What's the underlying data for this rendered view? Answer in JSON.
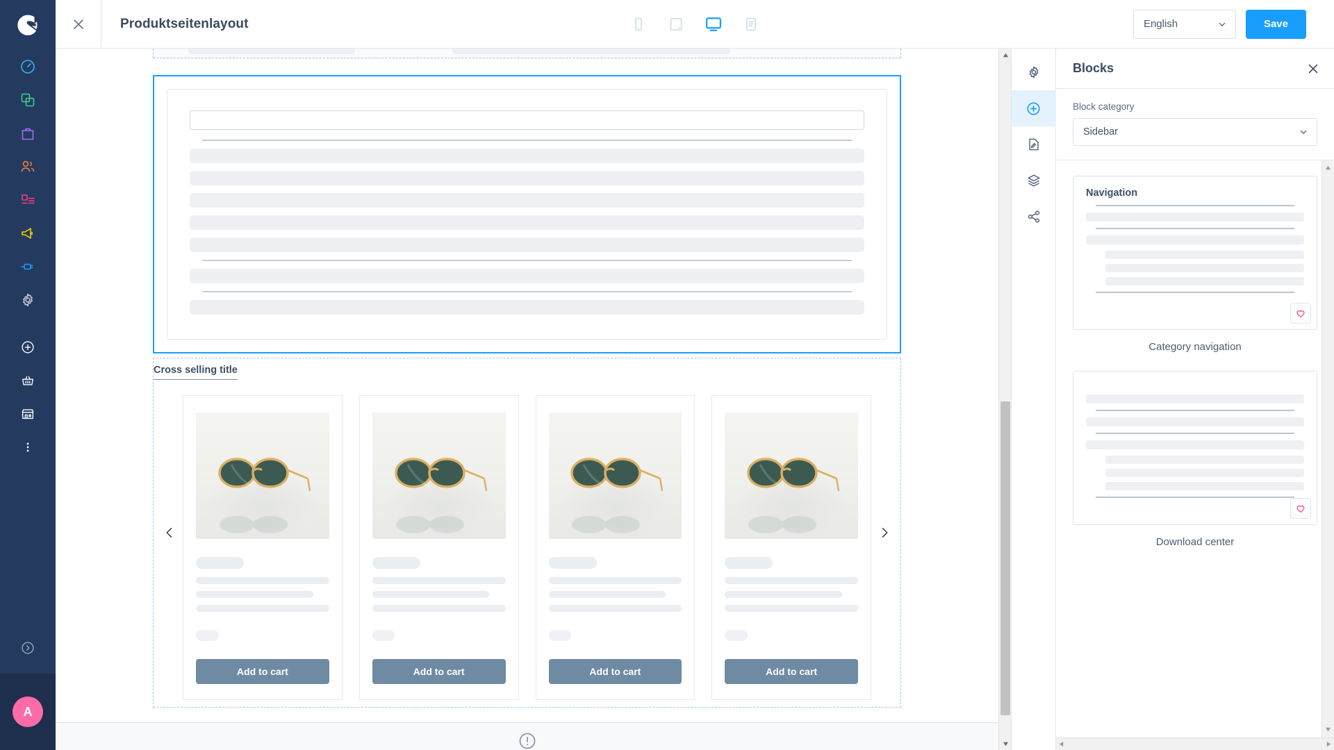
{
  "app": {
    "brand_logo": "shopware-logo-icon",
    "rail_nav": [
      {
        "name": "dashboard",
        "icon": "gauge-icon",
        "color": "#37b6f3"
      },
      {
        "name": "catalogues",
        "icon": "copy-squares-icon",
        "color": "#3ecf8e"
      },
      {
        "name": "orders",
        "icon": "shopping-bag-icon",
        "color": "#a06ef5"
      },
      {
        "name": "customers",
        "icon": "users-icon",
        "color": "#f2813f"
      },
      {
        "name": "content",
        "icon": "content-layout-icon",
        "color": "#f0407f"
      },
      {
        "name": "marketing",
        "icon": "megaphone-icon",
        "color": "#ffd500"
      },
      {
        "name": "extensions",
        "icon": "plug-icon",
        "color": "#189eff"
      },
      {
        "name": "settings",
        "icon": "gear-icon",
        "color": "#c3cbd6"
      }
    ],
    "rail_nav_secondary": [
      {
        "name": "add-new",
        "icon": "plus-circle-icon",
        "color": "#ffffff"
      },
      {
        "name": "shopping-basket",
        "icon": "basket-icon",
        "color": "#ffffff"
      },
      {
        "name": "storefront",
        "icon": "store-icon",
        "color": "#ffffff"
      },
      {
        "name": "more-options",
        "icon": "kebab-menu-icon",
        "color": "#ffffff"
      }
    ],
    "rail_expand_icon": "chevron-right-circle-icon",
    "avatar_initial": "A",
    "avatar_color": "#ff6ba6"
  },
  "topbar": {
    "close_icon": "close-x-icon",
    "title": "Produktseitenlayout",
    "devices": [
      {
        "name": "mobile",
        "icon": "mobile-icon",
        "active": false
      },
      {
        "name": "tablet",
        "icon": "tablet-icon",
        "active": false
      },
      {
        "name": "desktop",
        "icon": "desktop-icon",
        "active": true
      },
      {
        "name": "form",
        "icon": "form-list-icon",
        "active": false
      }
    ],
    "language_value": "English",
    "language_chevron": "chevron-down-icon",
    "save_label": "Save",
    "accent_color": "#189eff"
  },
  "canvas": {
    "cross_selling": {
      "title": "Cross selling title",
      "prev_icon": "chevron-left-icon",
      "next_icon": "chevron-right-icon",
      "products": [
        {
          "image": "sunglasses-image",
          "cta": "Add to cart"
        },
        {
          "image": "sunglasses-image",
          "cta": "Add to cart"
        },
        {
          "image": "sunglasses-image",
          "cta": "Add to cart"
        },
        {
          "image": "sunglasses-image",
          "cta": "Add to cart"
        }
      ],
      "cta_color": "#6f8ba4"
    },
    "bottom_icon": "info-circle-icon",
    "selection_color": "#189eff"
  },
  "icon_rail": [
    {
      "name": "settings",
      "icon": "gear-icon",
      "active": false
    },
    {
      "name": "add-blocks",
      "icon": "plus-circle-icon",
      "active": true
    },
    {
      "name": "edit-content",
      "icon": "edit-document-icon",
      "active": false
    },
    {
      "name": "layers",
      "icon": "layers-icon",
      "active": false
    },
    {
      "name": "share",
      "icon": "share-nodes-icon",
      "active": false
    }
  ],
  "blocks_panel": {
    "title": "Blocks",
    "close_icon": "close-x-icon",
    "category_label": "Block category",
    "category_value": "Sidebar",
    "category_chevron": "chevron-down-icon",
    "items": [
      {
        "preview_title": "Navigation",
        "caption": "Category navigation",
        "favorite_icon": "heart-icon"
      },
      {
        "preview_title": "",
        "caption": "Download center",
        "favorite_icon": "heart-icon"
      }
    ],
    "favorite_color": "#ff4f8b"
  }
}
